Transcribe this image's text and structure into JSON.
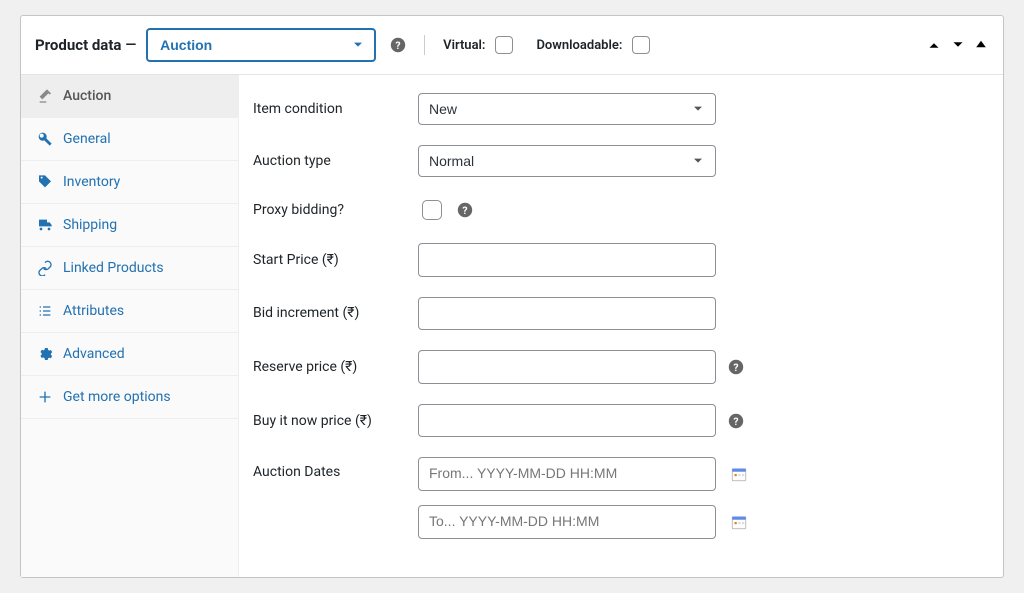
{
  "header": {
    "title": "Product data",
    "product_type": "Auction",
    "virtual_label": "Virtual:",
    "downloadable_label": "Downloadable:"
  },
  "tabs": [
    {
      "label": "Auction",
      "key": "auction",
      "active": true
    },
    {
      "label": "General",
      "key": "general",
      "active": false
    },
    {
      "label": "Inventory",
      "key": "inventory",
      "active": false
    },
    {
      "label": "Shipping",
      "key": "shipping",
      "active": false
    },
    {
      "label": "Linked Products",
      "key": "linked-products",
      "active": false
    },
    {
      "label": "Attributes",
      "key": "attributes",
      "active": false
    },
    {
      "label": "Advanced",
      "key": "advanced",
      "active": false
    },
    {
      "label": "Get more options",
      "key": "get-more",
      "active": false
    }
  ],
  "fields": {
    "item_condition": {
      "label": "Item condition",
      "value": "New"
    },
    "auction_type": {
      "label": "Auction type",
      "value": "Normal"
    },
    "proxy_bidding": {
      "label": "Proxy bidding?"
    },
    "start_price": {
      "label": "Start Price (₹)",
      "value": ""
    },
    "bid_increment": {
      "label": "Bid increment (₹)",
      "value": ""
    },
    "reserve_price": {
      "label": "Reserve price (₹)",
      "value": ""
    },
    "buy_it_now_price": {
      "label": "Buy it now price (₹)",
      "value": ""
    },
    "auction_dates": {
      "label": "Auction Dates",
      "from_placeholder": "From... YYYY-MM-DD HH:MM",
      "to_placeholder": "To... YYYY-MM-DD HH:MM"
    }
  }
}
